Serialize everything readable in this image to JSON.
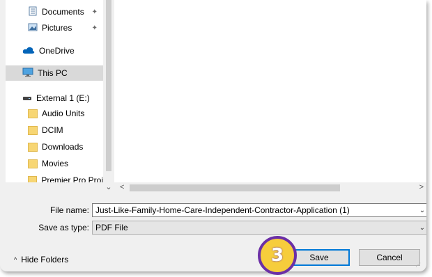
{
  "nav": {
    "items": [
      {
        "label": "Documents",
        "icon": "documents-icon",
        "pinned": true
      },
      {
        "label": "Pictures",
        "icon": "pictures-icon",
        "pinned": true
      },
      {
        "label": "OneDrive",
        "icon": "onedrive-icon"
      },
      {
        "label": "This PC",
        "icon": "computer-icon",
        "selected": true
      },
      {
        "label": "External 1 (E:)",
        "icon": "drive-icon"
      },
      {
        "label": "Audio Units",
        "icon": "folder-icon"
      },
      {
        "label": "DCIM",
        "icon": "folder-icon"
      },
      {
        "label": "Downloads",
        "icon": "folder-icon"
      },
      {
        "label": "Movies",
        "icon": "folder-icon"
      },
      {
        "label": "Premier Pro Proj",
        "icon": "folder-icon"
      }
    ],
    "pin_glyph": "📌",
    "scroll_down": "⌄"
  },
  "hscroll": {
    "left": "<",
    "right": ">"
  },
  "form": {
    "file_name_label": "File name:",
    "file_name_value": "Just-Like-Family-Home-Care-Independent-Contractor-Application (1)",
    "save_type_label": "Save as type:",
    "save_type_value": "PDF File",
    "dropdown_glyph": "⌄"
  },
  "footer": {
    "hide_folders": "Hide Folders",
    "hide_chevron": "^",
    "save": "Save",
    "cancel": "Cancel",
    "step_number": "3"
  },
  "colors": {
    "folder": "#f7d674",
    "accent": "#0078d7",
    "badge_fill": "#f6cd3c",
    "badge_border": "#6b2fa6"
  }
}
